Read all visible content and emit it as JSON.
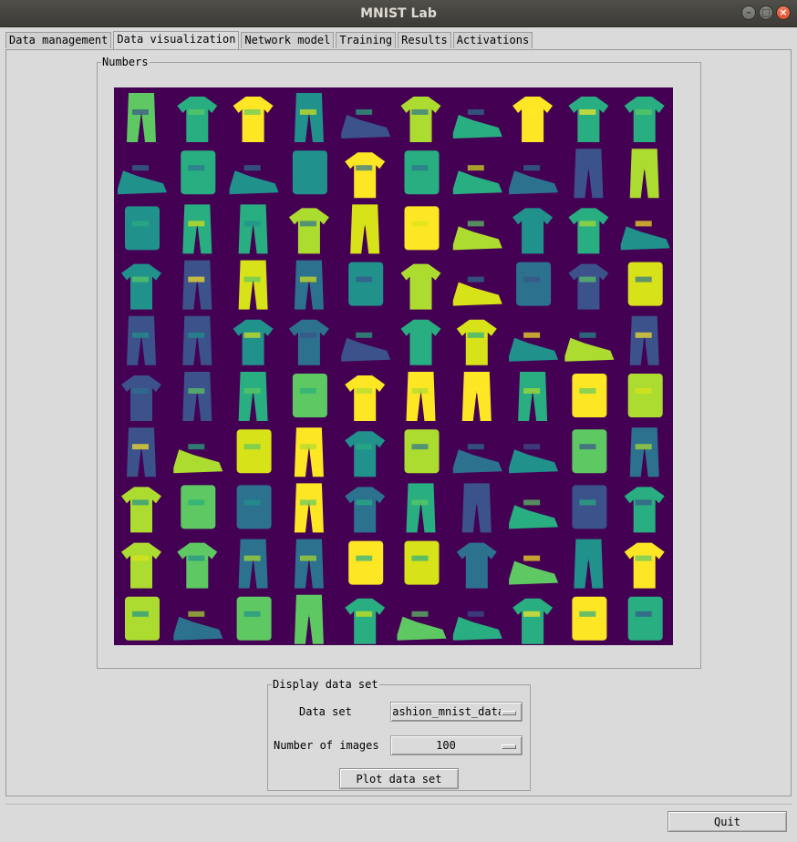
{
  "window": {
    "title": "MNIST Lab"
  },
  "tabs": [
    {
      "label": "Data management"
    },
    {
      "label": "Data visualization"
    },
    {
      "label": "Network model"
    },
    {
      "label": "Training"
    },
    {
      "label": "Results"
    },
    {
      "label": "Activations"
    }
  ],
  "active_tab": 1,
  "numbers_panel": {
    "label": "Numbers",
    "grid": {
      "rows": 10,
      "cols": 10,
      "background": "#440154",
      "colormap": "viridis"
    }
  },
  "display_panel": {
    "label": "Display data set",
    "data_set_label": "Data set",
    "data_set_value": "fashion_mnist_data",
    "num_images_label": "Number of images",
    "num_images_value": "100",
    "plot_button": "Plot data set"
  },
  "quit_button": "Quit",
  "colors": {
    "titlebar": "#3c3b37",
    "close_button": "#e95420",
    "viridis_dark": "#440154"
  }
}
